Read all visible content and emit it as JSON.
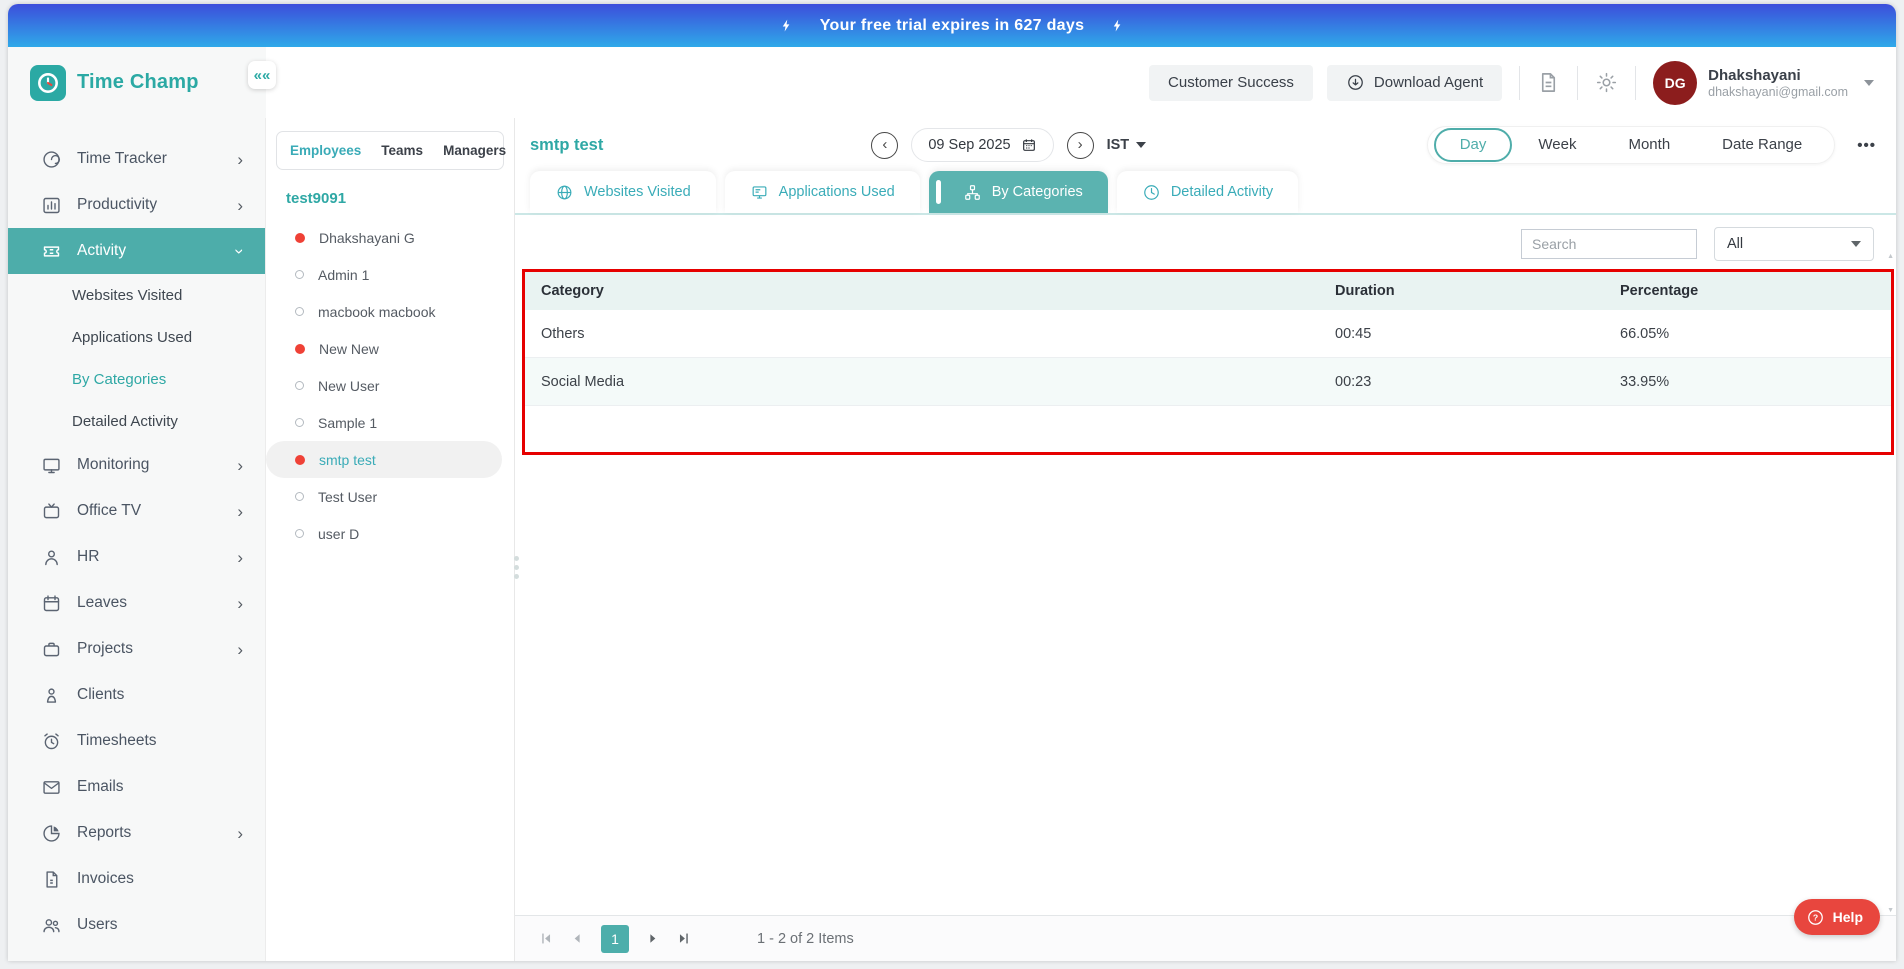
{
  "banner": {
    "text": "Your free trial expires in 627 days"
  },
  "header": {
    "logo_text": "Time Champ",
    "collapse_glyph": "««",
    "customer_success_label": "Customer Success",
    "download_agent_label": "Download Agent",
    "user": {
      "initials": "DG",
      "name": "Dhakshayani",
      "email": "dhakshayani@gmail.com"
    }
  },
  "sidebar": {
    "items": [
      {
        "label": "Time Tracker"
      },
      {
        "label": "Productivity"
      },
      {
        "label": "Activity"
      },
      {
        "label": "Monitoring"
      },
      {
        "label": "Office TV"
      },
      {
        "label": "HR"
      },
      {
        "label": "Leaves"
      },
      {
        "label": "Projects"
      },
      {
        "label": "Clients"
      },
      {
        "label": "Timesheets"
      },
      {
        "label": "Emails"
      },
      {
        "label": "Reports"
      },
      {
        "label": "Invoices"
      },
      {
        "label": "Users"
      }
    ],
    "activity_children": [
      "Websites Visited",
      "Applications Used",
      "By Categories",
      "Detailed Activity"
    ],
    "active_item": "Activity",
    "active_child": "By Categories"
  },
  "employees": {
    "tabs": [
      "Employees",
      "Teams",
      "Managers"
    ],
    "active_tab": "Employees",
    "group": "test9091",
    "list": [
      {
        "name": "Dhakshayani G",
        "status": "online"
      },
      {
        "name": "Admin 1",
        "status": "offline"
      },
      {
        "name": "macbook macbook",
        "status": "offline"
      },
      {
        "name": "New New",
        "status": "online"
      },
      {
        "name": "New User",
        "status": "offline"
      },
      {
        "name": "Sample 1",
        "status": "offline"
      },
      {
        "name": "smtp test",
        "status": "online",
        "selected": true
      },
      {
        "name": "Test User",
        "status": "offline"
      },
      {
        "name": "user D",
        "status": "offline"
      }
    ]
  },
  "main": {
    "title": "smtp test",
    "date": "09 Sep 2025",
    "timezone": "IST",
    "views": [
      "Day",
      "Week",
      "Month",
      "Date Range"
    ],
    "active_view": "Day",
    "more_label": "•••",
    "tabs": [
      {
        "label": "Websites Visited"
      },
      {
        "label": "Applications Used"
      },
      {
        "label": "By Categories",
        "active": true
      },
      {
        "label": "Detailed Activity"
      }
    ],
    "search_placeholder": "Search",
    "filter_value": "All",
    "table": {
      "columns": [
        "Category",
        "Duration",
        "Percentage"
      ],
      "rows": [
        [
          "Others",
          "00:45",
          "66.05%"
        ],
        [
          "Social Media",
          "00:23",
          "33.95%"
        ]
      ]
    },
    "pagination": {
      "page": "1",
      "summary": "1 - 2 of 2 Items"
    },
    "help_label": "Help"
  },
  "colors": {
    "teal_brand": "#2ba9a4",
    "teal_active_bg": "#4dadaa",
    "teal_tab_active": "#5bb3b0",
    "banner_top": "#3c4edb",
    "banner_bottom": "#2fa9e9",
    "annotation_red": "#e60000",
    "status_red": "#ef4136",
    "help_red": "#e8463e",
    "avatar_maroon": "#8c1d1d",
    "table_header_bg": "#e9f3f2",
    "row_alt_bg": "#f4faf9"
  }
}
